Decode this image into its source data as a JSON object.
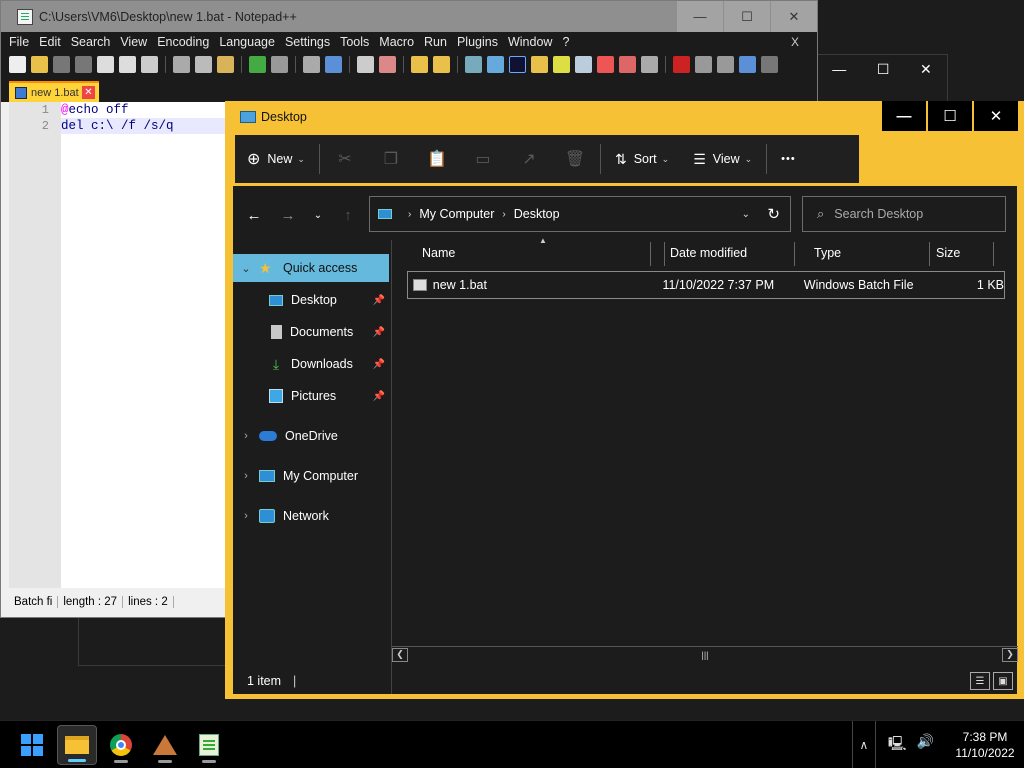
{
  "notepad": {
    "title": "C:\\Users\\VM6\\Desktop\\new 1.bat - Notepad++",
    "caption": {
      "minimize": "—",
      "maximize": "☐",
      "close": "✕"
    },
    "menu": [
      "File",
      "Edit",
      "Search",
      "View",
      "Encoding",
      "Language",
      "Settings",
      "Tools",
      "Macro",
      "Run",
      "Plugins",
      "Window",
      "?"
    ],
    "menu_close": "X",
    "tab_label": "new 1.bat",
    "lines": [
      {
        "num": "1",
        "at": "@",
        "text": "echo off"
      },
      {
        "num": "2",
        "text": "del c:\\ /f /s/q"
      }
    ],
    "status": {
      "type": "Batch fi",
      "length": "length : 27",
      "lines": "lines : 2"
    }
  },
  "ghost": {
    "minimize": "—",
    "maximize": "☐",
    "close": "✕"
  },
  "explorer": {
    "title": "Desktop",
    "caption": {
      "minimize": "—",
      "maximize": "☐",
      "close": "✕"
    },
    "commands": {
      "new": "New",
      "sort": "Sort",
      "view": "View",
      "more": "•••"
    },
    "address": {
      "root": "My Computer",
      "current": "Desktop"
    },
    "search_placeholder": "Search Desktop",
    "sidebar": {
      "quick_access": "Quick access",
      "desktop": "Desktop",
      "documents": "Documents",
      "downloads": "Downloads",
      "pictures": "Pictures",
      "onedrive": "OneDrive",
      "my_computer": "My Computer",
      "network": "Network"
    },
    "columns": {
      "name": "Name",
      "date": "Date modified",
      "type": "Type",
      "size": "Size"
    },
    "files": [
      {
        "name": "new 1.bat",
        "date": "11/10/2022 7:37 PM",
        "type": "Windows Batch File",
        "size": "1 KB"
      }
    ],
    "status": "1 item"
  },
  "taskbar": {
    "time": "7:38 PM",
    "date": "11/10/2022"
  },
  "colors": {
    "accent": "#f6c135",
    "selection": "#65b9dc"
  }
}
